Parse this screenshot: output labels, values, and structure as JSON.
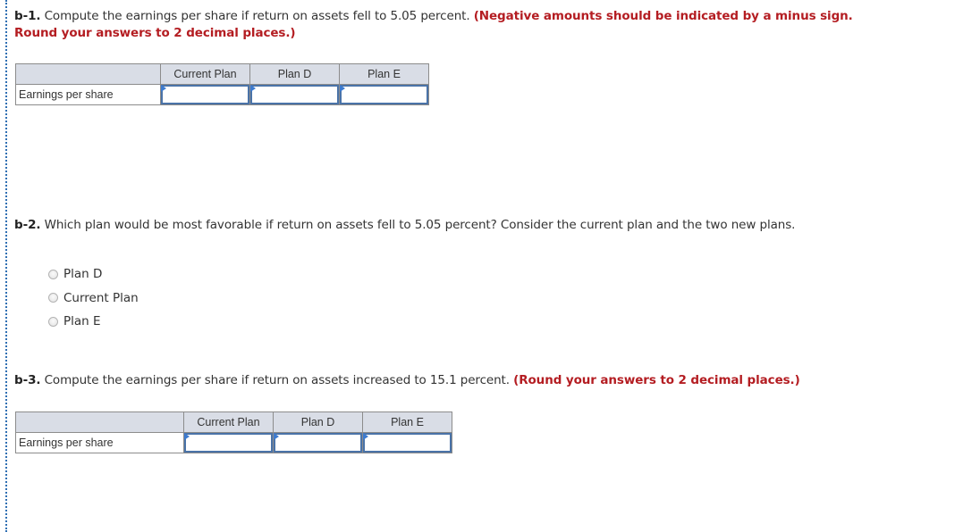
{
  "b1": {
    "label": "b-1.",
    "text": " Compute the earnings per share if return on assets fell to 5.05 percent. ",
    "note_line1": "(Negative amounts should be indicated by a minus sign.",
    "note_line2": "Round your answers to 2 decimal places.)",
    "table": {
      "headers": [
        "",
        "Current Plan",
        "Plan D",
        "Plan E"
      ],
      "row_label": "Earnings per share",
      "values": [
        "",
        "",
        ""
      ]
    }
  },
  "b2": {
    "label": "b-2.",
    "text": " Which plan would be most favorable if return on assets fell to 5.05 percent? Consider the current plan and the two new plans.",
    "options": [
      "Plan D",
      "Current Plan",
      "Plan E"
    ],
    "selected": null
  },
  "b3": {
    "label": "b-3.",
    "text": " Compute the earnings per share if return on assets increased to 15.1 percent. ",
    "note": "(Round your answers to 2 decimal places.)",
    "table": {
      "headers": [
        "",
        "Current Plan",
        "Plan D",
        "Plan E"
      ],
      "row_label": "Earnings per share",
      "values": [
        "",
        "",
        ""
      ]
    }
  },
  "colors": {
    "accent": "#2f6fb3",
    "instruction_red": "#b41d22",
    "header_bg": "#d9dde6",
    "input_border": "#4a73a8"
  }
}
